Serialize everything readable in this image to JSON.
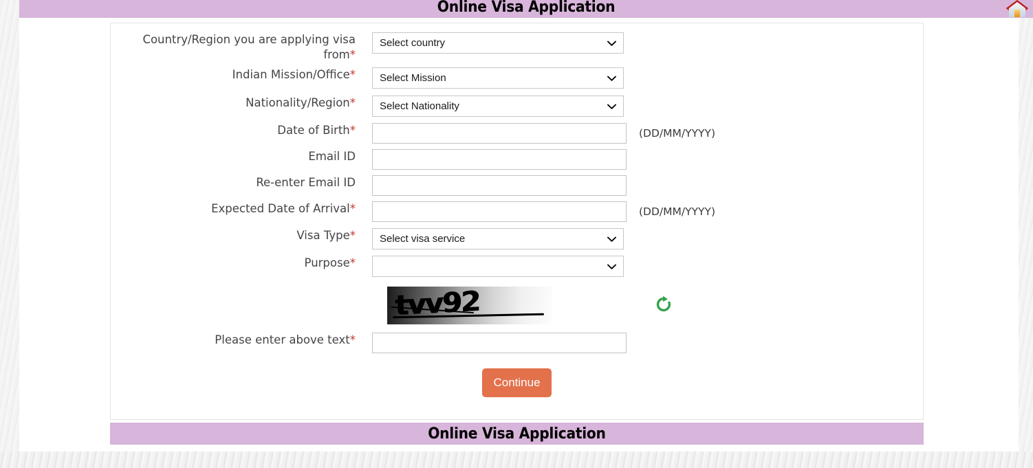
{
  "header": {
    "title": "Online Visa Application",
    "home_icon": "home-icon"
  },
  "footer": {
    "title": "Online Visa Application"
  },
  "form": {
    "rows": [
      {
        "label": "Country/Region you are applying visa from",
        "required": true,
        "control": "select",
        "value": "Select country",
        "hint": ""
      },
      {
        "label": "Indian Mission/Office",
        "required": true,
        "control": "select",
        "value": "Select Mission",
        "hint": ""
      },
      {
        "label": "Nationality/Region",
        "required": true,
        "control": "select",
        "value": "Select Nationality",
        "hint": ""
      },
      {
        "label": "Date of Birth",
        "required": true,
        "control": "input",
        "value": "",
        "hint": "(DD/MM/YYYY)"
      },
      {
        "label": "Email ID",
        "required": false,
        "control": "input",
        "value": "",
        "hint": ""
      },
      {
        "label": "Re-enter Email ID",
        "required": false,
        "control": "input",
        "value": "",
        "hint": ""
      },
      {
        "label": "Expected Date of Arrival",
        "required": true,
        "control": "input",
        "value": "",
        "hint": "(DD/MM/YYYY)"
      },
      {
        "label": "Visa Type",
        "required": true,
        "control": "select",
        "value": "Select visa service",
        "hint": ""
      },
      {
        "label": "Purpose",
        "required": true,
        "control": "select",
        "value": "",
        "hint": ""
      },
      {
        "label": "Please enter above text",
        "required": true,
        "control": "input",
        "value": "",
        "hint": ""
      }
    ],
    "captcha": {
      "text": "tvv92",
      "refresh_icon": "refresh-icon"
    },
    "submit_label": "Continue"
  },
  "colors": {
    "banner": "#d8b5da",
    "button": "#e3714c",
    "required_star": "#c0392b",
    "refresh_icon": "#33a14a",
    "label_text": "#444444"
  }
}
